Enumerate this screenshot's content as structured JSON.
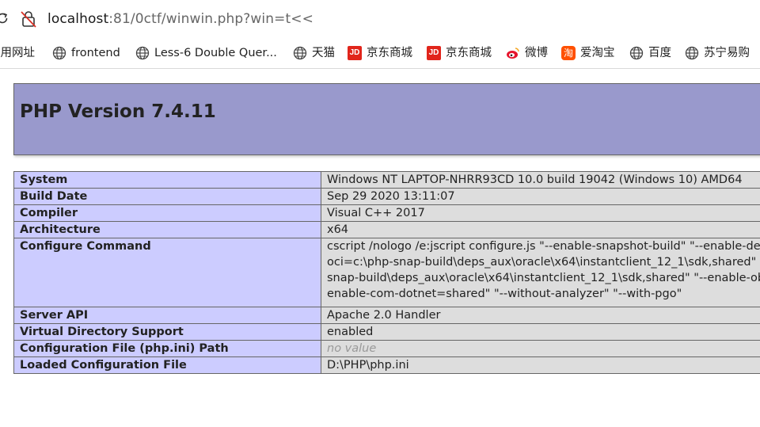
{
  "browser": {
    "url_host": "localhost",
    "url_rest": ":81/0ctf/winwin.php?win=t<<"
  },
  "bookmarks": [
    {
      "label": "常用网址",
      "icon": "none"
    },
    {
      "label": "frontend",
      "icon": "globe-icon"
    },
    {
      "label": "Less-6 Double Quer...",
      "icon": "globe-icon"
    },
    {
      "label": "天猫",
      "icon": "globe-icon"
    },
    {
      "label": "京东商城",
      "icon": "jd-icon"
    },
    {
      "label": "京东商城",
      "icon": "jd-icon"
    },
    {
      "label": "微博",
      "icon": "weibo-icon"
    },
    {
      "label": "爱淘宝",
      "icon": "taobao-icon"
    },
    {
      "label": "百度",
      "icon": "globe-icon"
    },
    {
      "label": "苏宁易购",
      "icon": "globe-icon"
    }
  ],
  "php": {
    "title": "PHP Version 7.4.11",
    "rows": [
      {
        "key": "System",
        "value": "Windows NT LAPTOP-NHRR93CD 10.0 build 19042 (Windows 10) AMD64"
      },
      {
        "key": "Build Date",
        "value": "Sep 29 2020 13:11:07"
      },
      {
        "key": "Compiler",
        "value": "Visual C++ 2017"
      },
      {
        "key": "Architecture",
        "value": "x64"
      },
      {
        "key": "Configure Command",
        "lines": [
          "cscript /nologo /e:jscript configure.js \"--enable-snapshot-build\" \"--enable-de",
          "oci=c:\\php-snap-build\\deps_aux\\oracle\\x64\\instantclient_12_1\\sdk,shared\" \"",
          "snap-build\\deps_aux\\oracle\\x64\\instantclient_12_1\\sdk,shared\" \"--enable-ob",
          "enable-com-dotnet=shared\" \"--without-analyzer\" \"--with-pgo\""
        ]
      },
      {
        "key": "Server API",
        "value": "Apache 2.0 Handler"
      },
      {
        "key": "Virtual Directory Support",
        "value": "enabled"
      },
      {
        "key": "Configuration File (php.ini) Path",
        "value": "no value"
      },
      {
        "key": "Loaded Configuration File",
        "value": "D:\\PHP\\php.ini"
      }
    ]
  }
}
